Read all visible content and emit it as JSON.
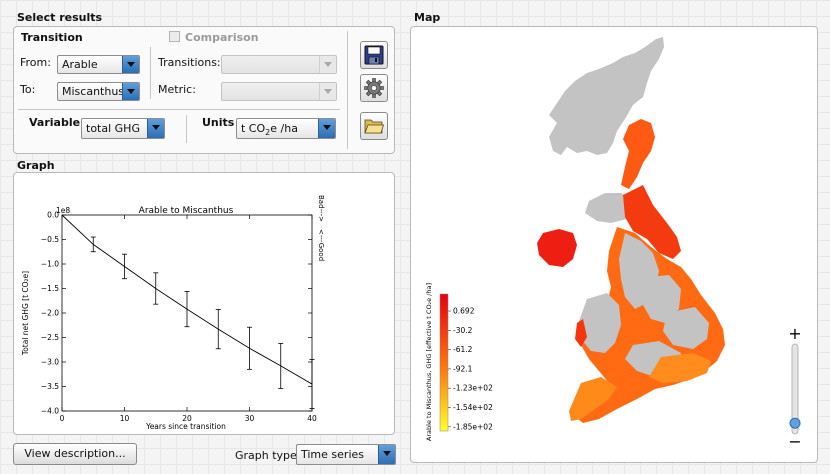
{
  "select_results": {
    "title": "Select results",
    "transition": {
      "heading": "Transition",
      "from_label": "From:",
      "from_value": "Arable",
      "to_label": "To:",
      "to_value": "Miscanthus",
      "comparison_label": "Comparison",
      "transitions_label": "Transitions:",
      "transitions_value": "",
      "metric_label": "Metric:",
      "metric_value": ""
    },
    "variable": {
      "label": "Variable",
      "value": "total GHG"
    },
    "units": {
      "label": "Units",
      "value_main": "t CO",
      "value_sub": "2",
      "value_rest": "e /ha"
    }
  },
  "toolbar": {
    "save_icon": "floppy-disk-icon",
    "settings_icon": "gear-icon",
    "open_icon": "folder-icon"
  },
  "graph": {
    "title": "Graph",
    "view_description_label": "View description...",
    "graph_type_label": "Graph type:",
    "graph_type_value": "Time series"
  },
  "chart_data": {
    "type": "line",
    "title": "Arable to Miscanthus",
    "xlabel": "Years since transition",
    "ylabel": "Total net GHG [t CO₂e]",
    "y_multiplier": "1e8",
    "xlim": [
      0,
      40
    ],
    "ylim": [
      -4.0,
      0.0
    ],
    "x_ticks": [
      "0",
      "10",
      "20",
      "30",
      "40"
    ],
    "y_ticks": [
      "0.0",
      "−0.5",
      "−1.0",
      "−1.5",
      "−2.0",
      "−2.5",
      "−3.0",
      "−3.5",
      "−4.0"
    ],
    "right_annotation_top": "Bad--->",
    "right_annotation_bottom": "<---Good",
    "series": [
      {
        "x": [
          0,
          5,
          10,
          15,
          20,
          25,
          30,
          35,
          40
        ],
        "y": [
          0.0,
          -0.6,
          -1.05,
          -1.5,
          -1.92,
          -2.33,
          -2.72,
          -3.08,
          -3.45
        ],
        "err": [
          0.0,
          0.15,
          0.25,
          0.32,
          0.36,
          0.4,
          0.43,
          0.46,
          0.5
        ]
      }
    ]
  },
  "map": {
    "title": "Map",
    "legend_title": "Arable to Miscanthus, GHG [effective t CO₂e /ha]",
    "legend_ticks": [
      "0.692",
      "-30.2",
      "-61.2",
      "-92.1",
      "-1.23e+02",
      "-1.54e+02",
      "-1.85e+02"
    ],
    "colors": {
      "high": "#e8000b",
      "mid": "#ff7a10",
      "low": "#ffff2a",
      "land": "#c3c3c3"
    },
    "zoom_in_label": "+",
    "zoom_out_label": "−",
    "zoom_level": 0.12
  }
}
